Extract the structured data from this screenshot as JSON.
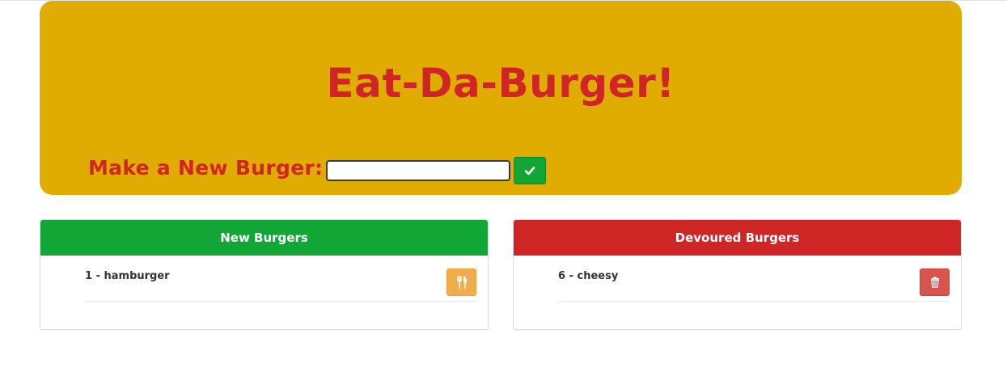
{
  "header": {
    "title": "Eat-Da-Burger!",
    "form_label": "Make a New Burger:",
    "input_value": "",
    "input_placeholder": "",
    "submit_icon": "check-icon"
  },
  "panels": {
    "new": {
      "heading": "New Burgers",
      "items": [
        {
          "text": "1 - hamburger",
          "action_icon": "cutlery-icon"
        }
      ]
    },
    "devoured": {
      "heading": "Devoured Burgers",
      "items": [
        {
          "text": "6 - cheesy",
          "action_icon": "trash-icon"
        }
      ]
    }
  },
  "colors": {
    "jumbotron": "#e0ac01",
    "title_red": "#d02525",
    "green": "#11a636",
    "red": "#d02525",
    "warning_orange": "#f0ad4e",
    "danger_red": "#d9534f"
  }
}
